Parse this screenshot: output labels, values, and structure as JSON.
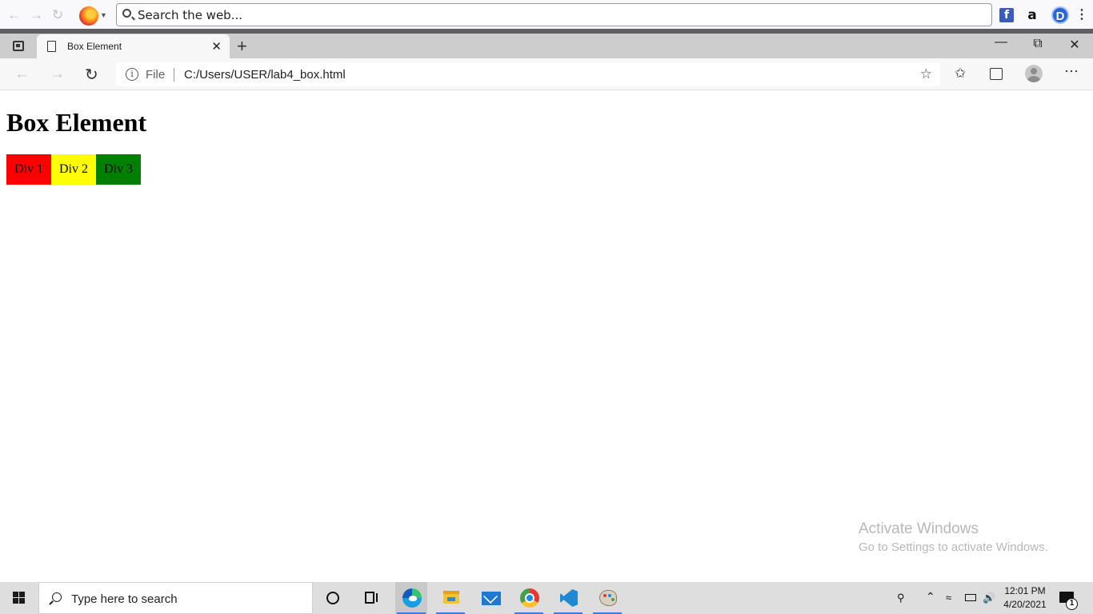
{
  "firefox_bar": {
    "search_placeholder": "Search the web...",
    "extensions": {
      "facebook": "f",
      "amazon": "a",
      "d_ext": "D"
    }
  },
  "tabs": [
    {
      "title": "Box Element",
      "active": true
    }
  ],
  "address_bar": {
    "scheme_label": "File",
    "url": "C:/Users/USER/lab4_box.html"
  },
  "page": {
    "heading": "Box Element",
    "boxes": [
      {
        "label": "Div 1",
        "color": "#ff0000"
      },
      {
        "label": "Div 2",
        "color": "#ffff00"
      },
      {
        "label": "Div 3",
        "color": "#008000"
      }
    ]
  },
  "watermark": {
    "title": "Activate Windows",
    "subtitle": "Go to Settings to activate Windows."
  },
  "taskbar": {
    "search_placeholder": "Type here to search",
    "clock_time": "12:01 PM",
    "clock_date": "4/20/2021",
    "notification_count": "1"
  }
}
